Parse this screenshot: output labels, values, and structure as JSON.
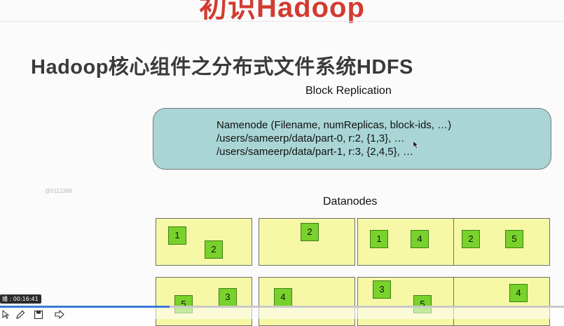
{
  "slide": {
    "top_title": "初识Hadoop",
    "heading": "Hadoop核心组件之分布式文件系统HDFS",
    "block_replication_label": "Block Replication",
    "datanodes_label": "Datanodes",
    "watermark": "@5112396"
  },
  "namenode": {
    "lines": [
      "Namenode (Filename, numReplicas, block-ids, …)",
      "/users/sameerp/data/part-0, r:2, {1,3}, …",
      "/users/sameerp/data/part-1, r:3, {2,4,5}, …"
    ]
  },
  "datanodes": [
    [
      "1",
      "2"
    ],
    [
      "2"
    ],
    [
      "1",
      "4"
    ],
    [
      "2",
      "5"
    ],
    [
      "5",
      "3"
    ],
    [
      "4"
    ],
    [
      "3",
      "5"
    ],
    [
      "4"
    ]
  ],
  "player": {
    "time": "播 : 00:16:41",
    "progress": 0.3,
    "icons": [
      "arrow-icon",
      "pen-icon",
      "save-icon",
      "forward-icon"
    ]
  },
  "colors": {
    "namenode_fill": "#a9d5d5",
    "datanode_fill": "#f6f8a6",
    "block_fill": "#78d22b",
    "title_red": "#d23b31",
    "progress_blue": "#3c78d8"
  }
}
